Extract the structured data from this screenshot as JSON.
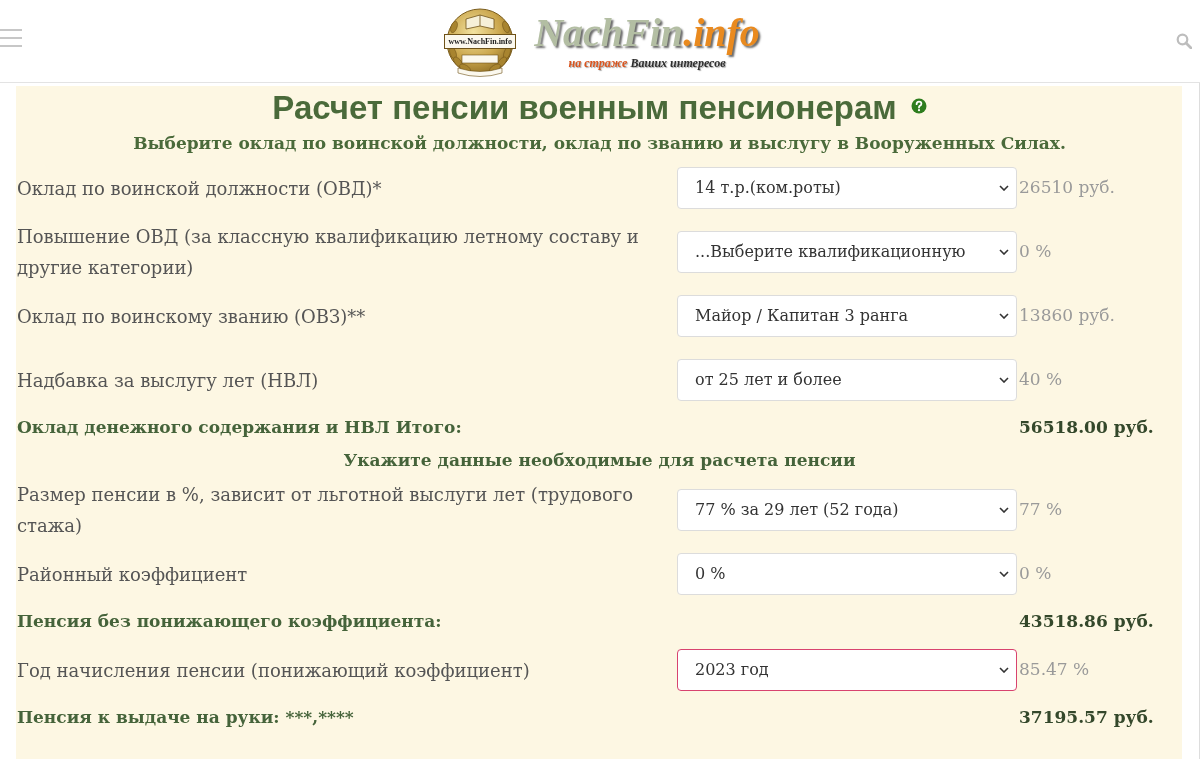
{
  "header": {
    "emblem_text": "www.NachFin.info",
    "wordmark": "NachFin",
    "wordmark_suffix": ".info",
    "tagline_accent": "на страже",
    "tagline": "Ваших интересов"
  },
  "form": {
    "title": "Расчет пенсии военным пенсионерам",
    "subtitle": "Выберите оклад по воинской должности, оклад по званию и выслугу в Вооруженных Силах.",
    "rows": [
      {
        "kind": "select",
        "label": "Оклад по воинской должности (ОВД)*",
        "select": {
          "value": "14 т.р.(ком.роты)",
          "focused": false
        },
        "result": "26510 руб."
      },
      {
        "kind": "select",
        "label": "Повышение ОВД (за классную квалификацию летному составу и другие категории)",
        "select": {
          "value": "...Выберите квалификационную",
          "focused": false
        },
        "result": "0 %"
      },
      {
        "kind": "select",
        "label": "Оклад по воинскому званию (ОВЗ)**",
        "select": {
          "value": "Майор / Капитан 3 ранга",
          "focused": false
        },
        "result": "13860 руб."
      },
      {
        "kind": "select",
        "label": "Надбавка за выслугу лет (НВЛ)",
        "select": {
          "value": "от 25 лет и более",
          "focused": false
        },
        "result": "40 %"
      },
      {
        "kind": "total",
        "label": "Оклад денежного содержания и НВЛ Итого:",
        "result": "56518.00 руб."
      },
      {
        "kind": "heading",
        "label": "Укажите данные необходимые для расчета пенсии"
      },
      {
        "kind": "select",
        "label": "Размер пенсии в %, зависит от льготной выслуги лет (трудового стажа)",
        "select": {
          "value": "77 % за 29 лет (52 года)",
          "focused": false
        },
        "result": "77 %"
      },
      {
        "kind": "select",
        "label": "Районный коэффициент",
        "select": {
          "value": "0 %",
          "focused": false
        },
        "result": "0 %"
      },
      {
        "kind": "total",
        "label": "Пенсия без понижающего коэффициента:",
        "result": "43518.86 руб."
      },
      {
        "kind": "select",
        "label": "Год начисления пенсии (понижающий коэффициент)",
        "select": {
          "value": "2023 год",
          "focused": true
        },
        "result": "85.47 %"
      },
      {
        "kind": "total",
        "label": "Пенсия к выдаче на руки: ***,****",
        "result": "37195.57 руб."
      }
    ]
  }
}
